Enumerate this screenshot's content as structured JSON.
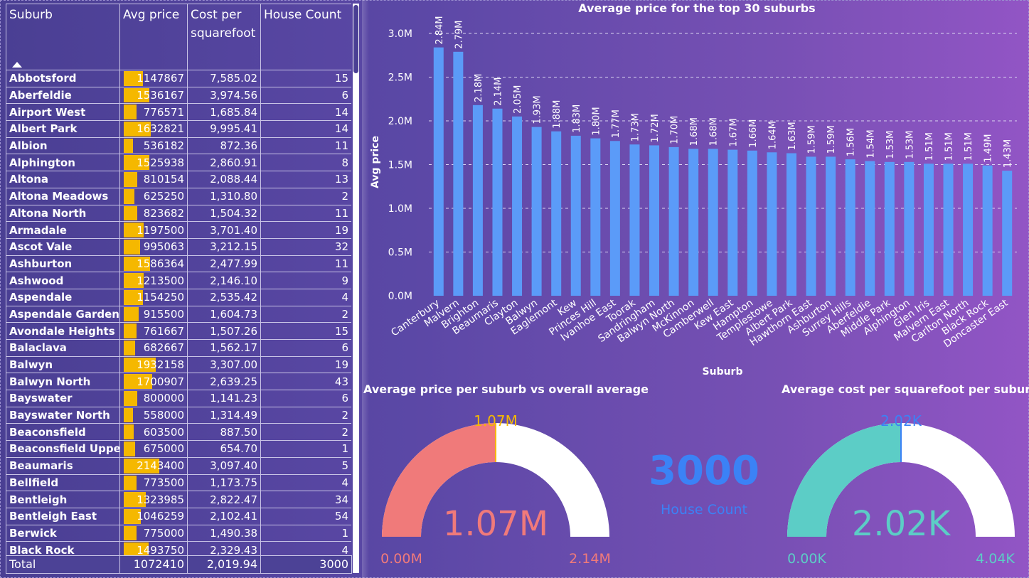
{
  "table": {
    "headers": [
      "Suburb",
      "Avg price",
      "Cost per squarefoot",
      "House Count"
    ],
    "rows": [
      [
        "Abbotsford",
        1147867,
        "7,585.02",
        15
      ],
      [
        "Aberfeldie",
        1536167,
        "3,974.56",
        6
      ],
      [
        "Airport West",
        776571,
        "1,685.84",
        14
      ],
      [
        "Albert Park",
        1632821,
        "9,995.41",
        14
      ],
      [
        "Albion",
        536182,
        "872.36",
        11
      ],
      [
        "Alphington",
        1525938,
        "2,860.91",
        8
      ],
      [
        "Altona",
        810154,
        "2,088.44",
        13
      ],
      [
        "Altona Meadows",
        625250,
        "1,310.80",
        2
      ],
      [
        "Altona North",
        823682,
        "1,504.32",
        11
      ],
      [
        "Armadale",
        1197500,
        "3,701.40",
        19
      ],
      [
        "Ascot Vale",
        995063,
        "3,212.15",
        32
      ],
      [
        "Ashburton",
        1586364,
        "2,477.99",
        11
      ],
      [
        "Ashwood",
        1213500,
        "2,146.10",
        9
      ],
      [
        "Aspendale",
        1154250,
        "2,535.42",
        4
      ],
      [
        "Aspendale Gardens",
        915500,
        "1,604.73",
        2
      ],
      [
        "Avondale Heights",
        761667,
        "1,507.26",
        15
      ],
      [
        "Balaclava",
        682667,
        "1,562.17",
        6
      ],
      [
        "Balwyn",
        1932158,
        "3,307.00",
        19
      ],
      [
        "Balwyn North",
        1700907,
        "2,639.25",
        43
      ],
      [
        "Bayswater",
        800000,
        "1,141.23",
        6
      ],
      [
        "Bayswater North",
        558000,
        "1,314.49",
        2
      ],
      [
        "Beaconsfield",
        603500,
        "887.50",
        2
      ],
      [
        "Beaconsfield Upper",
        675000,
        "654.70",
        1
      ],
      [
        "Beaumaris",
        2143400,
        "3,097.40",
        5
      ],
      [
        "Bellfield",
        773500,
        "1,173.75",
        4
      ],
      [
        "Bentleigh",
        1323985,
        "2,822.47",
        34
      ],
      [
        "Bentleigh East",
        1046259,
        "2,102.41",
        54
      ],
      [
        "Berwick",
        775000,
        "1,490.38",
        1
      ],
      [
        "Black Rock",
        1493750,
        "2,329.43",
        4
      ]
    ],
    "total": {
      "label": "Total",
      "avg": "1072410",
      "cost": "2,019.94",
      "count": "3000"
    },
    "bar_color": "#f5b800"
  },
  "chart_data": [
    {
      "type": "bar",
      "title": "Average price for the top 30 suburbs",
      "xlabel": "Suburb",
      "ylabel": "Avg price",
      "categories": [
        "Canterbury",
        "Malvern",
        "Brighton",
        "Beaumaris",
        "Clayton",
        "Balwyn",
        "Eaglemont",
        "Kew",
        "Princes Hill",
        "Ivanhoe East",
        "Toorak",
        "Sandringham",
        "Balwyn North",
        "McKinnon",
        "Camberwell",
        "Kew East",
        "Hampton",
        "Templestowe",
        "Albert Park",
        "Hawthorn East",
        "Ashburton",
        "Surrey Hills",
        "Aberfeldie",
        "Middle Park",
        "Alphington",
        "Glen Iris",
        "Malvern East",
        "Carlton North",
        "Black Rock",
        "Doncaster East"
      ],
      "values": [
        2.84,
        2.79,
        2.18,
        2.14,
        2.05,
        1.93,
        1.88,
        1.83,
        1.8,
        1.77,
        1.73,
        1.72,
        1.7,
        1.68,
        1.68,
        1.67,
        1.66,
        1.64,
        1.63,
        1.59,
        1.59,
        1.56,
        1.54,
        1.53,
        1.53,
        1.51,
        1.51,
        1.51,
        1.49,
        1.43
      ],
      "labels": [
        "2.84M",
        "2.79M",
        "2.18M",
        "2.14M",
        "2.05M",
        "1.93M",
        "1.88M",
        "1.83M",
        "1.80M",
        "1.77M",
        "1.73M",
        "1.72M",
        "1.70M",
        "1.68M",
        "1.68M",
        "1.67M",
        "1.66M",
        "1.64M",
        "1.63M",
        "1.59M",
        "1.59M",
        "1.56M",
        "1.54M",
        "1.53M",
        "1.53M",
        "1.51M",
        "1.51M",
        "1.51M",
        "1.49M",
        "1.43M"
      ],
      "yticks": [
        "0.0M",
        "0.5M",
        "1.0M",
        "1.5M",
        "2.0M",
        "2.5M",
        "3.0M"
      ],
      "ylim": [
        0,
        3.0
      ],
      "grid": true,
      "color": "#5b9bf8"
    },
    {
      "type": "gauge",
      "title": "Average price per suburb vs overall average",
      "value": 1.07,
      "min": 0,
      "max": 2.14,
      "target": 1.07,
      "value_label": "1.07M",
      "min_label": "0.00M",
      "max_label": "2.14M",
      "target_label": "1.07M",
      "fill_color": "#f07a7a",
      "target_color": "#f5b800"
    },
    {
      "type": "gauge",
      "title": "Average cost per squarefoot per suburb",
      "value": 2.02,
      "min": 0,
      "max": 4.04,
      "target": 2.02,
      "value_label": "2.02K",
      "min_label": "0.00K",
      "max_label": "4.04K",
      "target_label": "2.02K",
      "fill_color": "#5ccdc6",
      "target_color": "#3b82f6"
    }
  ],
  "kpi": {
    "value": "3000",
    "label": "House Count"
  }
}
